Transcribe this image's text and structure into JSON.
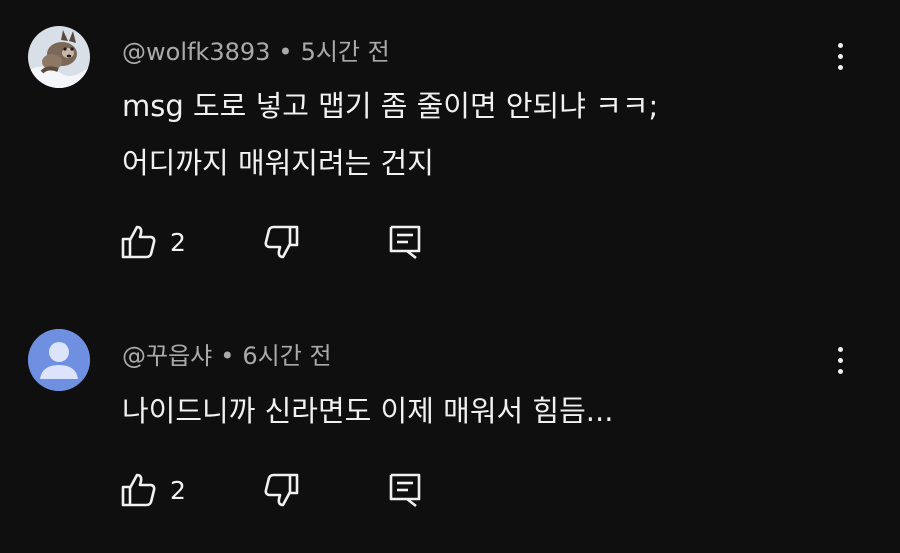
{
  "comments": [
    {
      "author": "@wolfk3893",
      "separator": "•",
      "time": "5시간 전",
      "lines": [
        "msg 도로 넣고 맵기 좀 줄이면 안되냐 ㅋㅋ;",
        "어디까지 매워지려는 건지"
      ],
      "likes": "2",
      "avatar": "wolf-photo-avatar"
    },
    {
      "author": "@꾸읍샤",
      "separator": "•",
      "time": "6시간 전",
      "lines": [
        "나이드니까 신라면도 이제 매워서 힘듬..."
      ],
      "likes": "2",
      "avatar": "default-person-avatar"
    }
  ],
  "colors": {
    "background": "#0f0f0f",
    "text": "#f1f1f1",
    "meta": "#aaaaaa",
    "default_avatar": "#6f8fe0"
  }
}
